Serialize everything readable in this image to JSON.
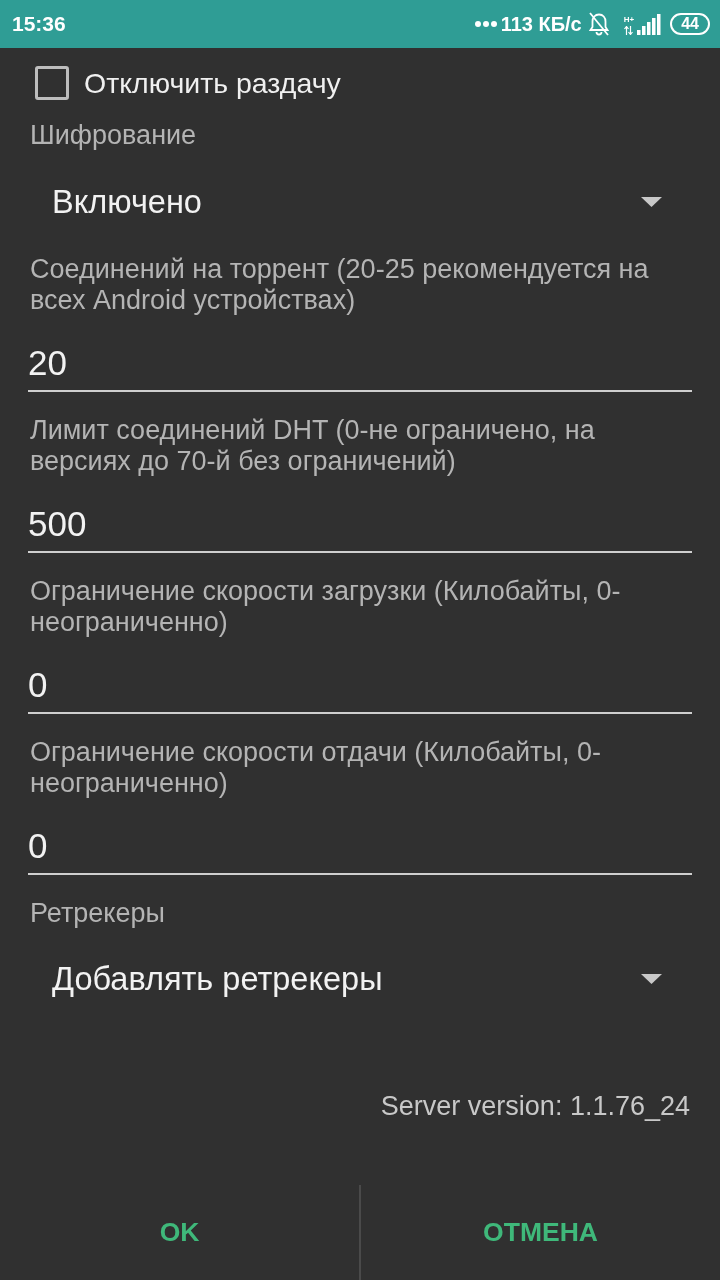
{
  "status_bar": {
    "time": "15:36",
    "net_speed": "113 КБ/с",
    "network_type": "H+",
    "battery": "44"
  },
  "settings": [
    {
      "kind": "checkbox",
      "label": "Отключить раздачу",
      "checked": false
    },
    {
      "kind": "spinner",
      "label": "Шифрование",
      "value": "Включено"
    },
    {
      "kind": "input",
      "label": "Соединений на торрент (20-25 рекомендуется на всех Android устройствах)",
      "value": "20"
    },
    {
      "kind": "input",
      "label": "Лимит соединений DHT (0-не ограничено, на версиях до 70-й без ограничений)",
      "value": "500"
    },
    {
      "kind": "input",
      "label": "Ограничение скорости загрузки (Килобайты, 0-неограниченно)",
      "value": "0"
    },
    {
      "kind": "input",
      "label": "Ограничение скорости отдачи (Килобайты, 0-неограниченно)",
      "value": "0"
    },
    {
      "kind": "spinner",
      "label": "Ретрекеры",
      "value": "Добавлять ретрекеры"
    }
  ],
  "server_version": "Server version: 1.1.76_24",
  "buttons": [
    "OK",
    "ОТМЕНА"
  ]
}
